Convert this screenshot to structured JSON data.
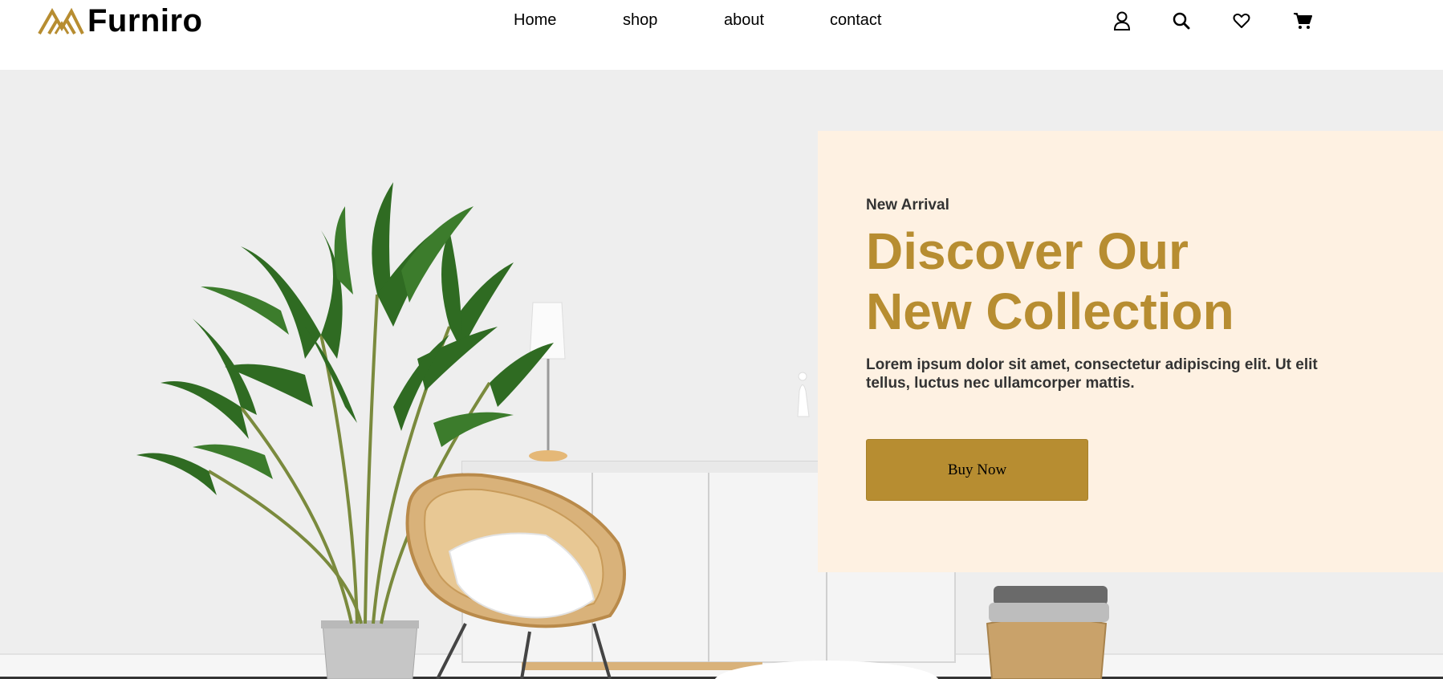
{
  "header": {
    "brand": "Furniro",
    "nav": [
      "Home",
      "shop",
      "about",
      "contact"
    ],
    "icons": [
      "user-icon",
      "search-icon",
      "heart-icon",
      "cart-icon"
    ]
  },
  "hero": {
    "eyebrow": "New Arrival",
    "headline_line1": "Discover Our",
    "headline_line2": "New Collection",
    "description": "Lorem ipsum dolor sit amet, consectetur adipiscing elit. Ut elit tellus, luctus nec ullamcorper mattis.",
    "cta": "Buy Now"
  },
  "colors": {
    "accent": "#b78d31",
    "panel_bg": "#fef1e2",
    "hero_bg": "#eeeeee"
  }
}
